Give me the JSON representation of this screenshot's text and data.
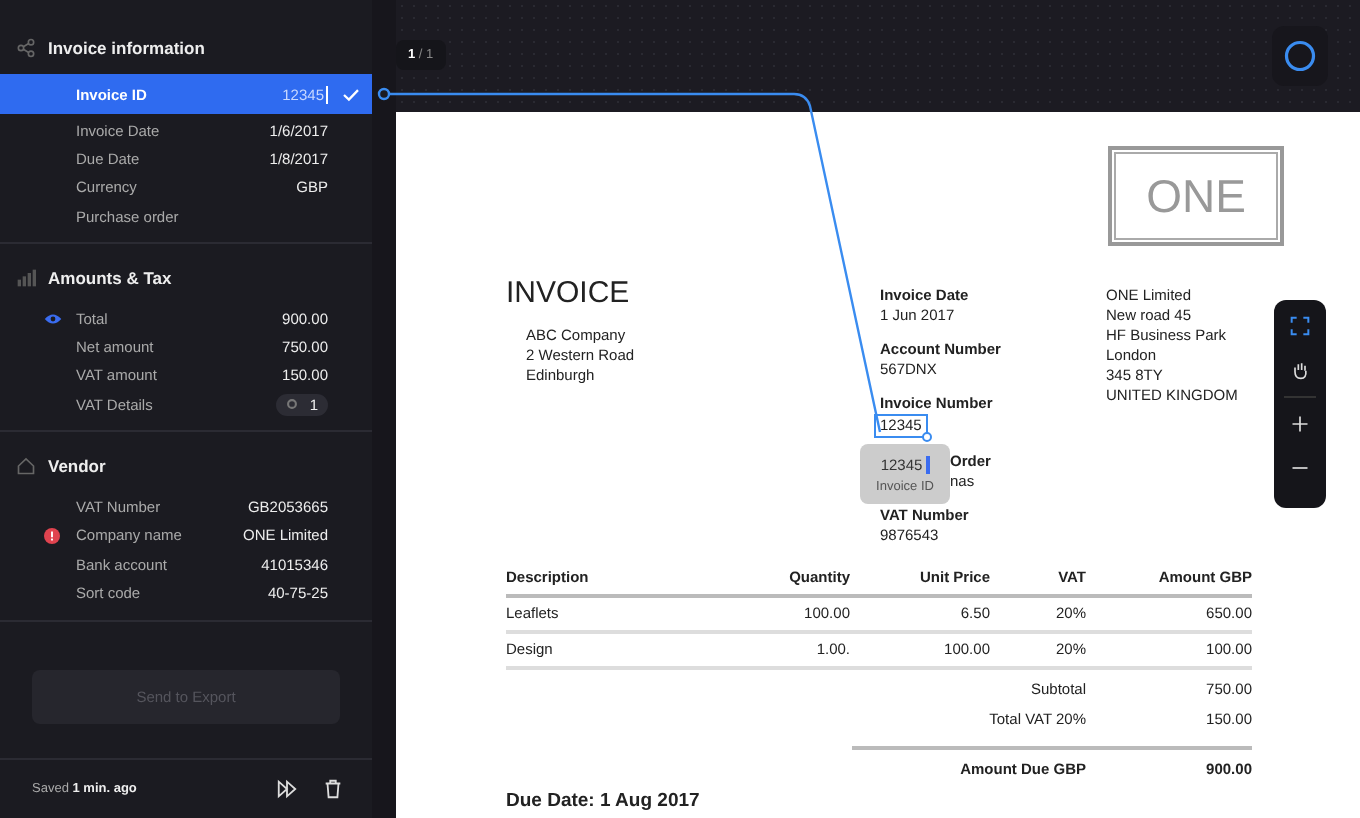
{
  "sidebar": {
    "sections": [
      {
        "kind": "fields",
        "title": "Invoice information",
        "rows": [
          {
            "kind": "text",
            "label": "Invoice ID",
            "value": "12345",
            "selected": true
          },
          {
            "kind": "text",
            "label": "Invoice Date",
            "value": "1/6/2017",
            "selected": false
          },
          {
            "kind": "text",
            "label": "Due Date",
            "value": "1/8/2017",
            "selected": false
          },
          {
            "kind": "text",
            "label": "Currency",
            "value": "GBP",
            "selected": false
          },
          {
            "kind": "text",
            "label": "Purchase order",
            "selected": false
          }
        ]
      },
      {
        "kind": "amounts",
        "title": "Amounts & Tax",
        "rows": [
          {
            "kind": "text",
            "label": "Total",
            "value": "900.00",
            "selected": false,
            "shown": true
          },
          {
            "kind": "text",
            "label": "Net amount",
            "value": "750.00",
            "selected": false,
            "shown": false
          },
          {
            "kind": "text",
            "label": "VAT amount",
            "value": "150.00",
            "selected": false,
            "shown": false
          },
          {
            "kind": "badge",
            "label": "VAT Details",
            "value": "1",
            "selected": false,
            "shown": false
          }
        ]
      },
      {
        "kind": "vendor",
        "title": "Vendor",
        "rows": [
          {
            "kind": "text",
            "label": "VAT Number",
            "value": "GB2053665",
            "selected": false,
            "has_error": false
          },
          {
            "kind": "text",
            "label": "Company name",
            "value": "ONE Limited",
            "selected": false,
            "has_error": true
          },
          {
            "kind": "text",
            "label": "Bank account",
            "value": "41015346",
            "selected": false,
            "has_error": false
          },
          {
            "kind": "text",
            "label": "Sort code",
            "value": "40-75-25",
            "selected": false,
            "has_error": false
          }
        ]
      }
    ],
    "export_button": {
      "label": "Send to Export",
      "disabled": true
    },
    "saved": "Saved **1 min. ago**"
  },
  "viewer": {
    "page_indicator": "**1** / 1",
    "document": {
      "logo": "ONE",
      "title": "INVOICE",
      "from_address": [
        "ABC Company",
        "2 Western Road",
        "Edinburgh"
      ],
      "details": [
        {
          "label": "Invoice Date",
          "value": "1 Jun 2017",
          "highlighted": false
        },
        {
          "label": "Account Number",
          "value": "567DNX",
          "highlighted": false
        },
        {
          "label": "Invoice Number",
          "value": "12345",
          "highlighted": true
        },
        {
          "label": "Order",
          "value": "nas",
          "highlighted": false,
          "tooltip": {
            "value": "12345",
            "label": "Invoice ID"
          }
        },
        {
          "label": "VAT Number",
          "value": "9876543",
          "highlighted": false
        }
      ],
      "to_address": [
        "ONE Limited",
        "New road 45",
        "HF Business Park",
        "London",
        "345 8TY",
        "UNITED KINGDOM"
      ],
      "table": {
        "columns": [
          "Description",
          "Quantity",
          "Unit Price",
          "VAT",
          "Amount  GBP"
        ],
        "rows": [
          [
            "Leaflets",
            "100.00",
            "6.50",
            "20%",
            "650.00"
          ],
          [
            "Design",
            "1.00.",
            "100.00",
            "20%",
            "100.00"
          ]
        ]
      },
      "totals": [
        {
          "kind": "subtotal",
          "label": "Subtotal",
          "value": "750.00"
        },
        {
          "kind": "subtotal",
          "label": "Total VAT 20%",
          "value": "150.00"
        },
        {
          "kind": "due",
          "label": "Amount Due GBP",
          "value": "900.00"
        }
      ],
      "due_date": "Due Date: 1 Aug 2017"
    }
  }
}
